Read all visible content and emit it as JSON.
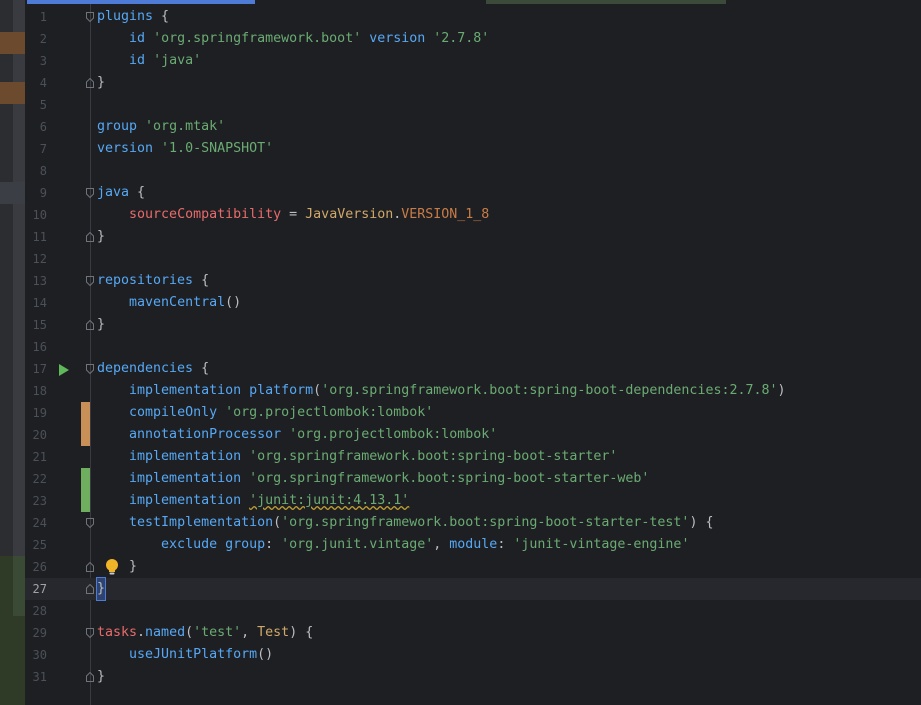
{
  "editor": {
    "lines": [
      {
        "n": "1",
        "tokens": [
          [
            "kw",
            "plugins"
          ],
          [
            "ident",
            " {"
          ]
        ],
        "fold": "open"
      },
      {
        "n": "2",
        "tokens": [
          [
            "ident",
            "    "
          ],
          [
            "kw",
            "id "
          ],
          [
            "str",
            "'org.springframework.boot'"
          ],
          [
            "kw",
            " version "
          ],
          [
            "str",
            "'2.7.8'"
          ]
        ]
      },
      {
        "n": "3",
        "tokens": [
          [
            "ident",
            "    "
          ],
          [
            "kw",
            "id "
          ],
          [
            "str",
            "'java'"
          ]
        ]
      },
      {
        "n": "4",
        "tokens": [
          [
            "ident",
            "}"
          ]
        ],
        "fold": "close"
      },
      {
        "n": "5",
        "tokens": []
      },
      {
        "n": "6",
        "tokens": [
          [
            "kw",
            "group "
          ],
          [
            "str",
            "'org.mtak'"
          ]
        ]
      },
      {
        "n": "7",
        "tokens": [
          [
            "kw",
            "version "
          ],
          [
            "str",
            "'1.0-SNAPSHOT'"
          ]
        ]
      },
      {
        "n": "8",
        "tokens": []
      },
      {
        "n": "9",
        "tokens": [
          [
            "kw",
            "java"
          ],
          [
            "ident",
            " {"
          ]
        ],
        "fold": "open"
      },
      {
        "n": "10",
        "tokens": [
          [
            "ident",
            "    "
          ],
          [
            "red",
            "sourceCompatibility"
          ],
          [
            "ident",
            " = "
          ],
          [
            "cls",
            "JavaVersion"
          ],
          [
            "ident",
            "."
          ],
          [
            "const",
            "VERSION_1_8"
          ]
        ]
      },
      {
        "n": "11",
        "tokens": [
          [
            "ident",
            "}"
          ]
        ],
        "fold": "close"
      },
      {
        "n": "12",
        "tokens": []
      },
      {
        "n": "13",
        "tokens": [
          [
            "kw",
            "repositories"
          ],
          [
            "ident",
            " {"
          ]
        ],
        "fold": "open"
      },
      {
        "n": "14",
        "tokens": [
          [
            "ident",
            "    "
          ],
          [
            "kw",
            "mavenCentral"
          ],
          [
            "ident",
            "()"
          ]
        ]
      },
      {
        "n": "15",
        "tokens": [
          [
            "ident",
            "}"
          ]
        ],
        "fold": "close"
      },
      {
        "n": "16",
        "tokens": []
      },
      {
        "n": "17",
        "tokens": [
          [
            "kw",
            "dependencies"
          ],
          [
            "ident",
            " {"
          ]
        ],
        "fold": "open",
        "run": true
      },
      {
        "n": "18",
        "tokens": [
          [
            "ident",
            "    "
          ],
          [
            "kw",
            "implementation "
          ],
          [
            "kw",
            "platform"
          ],
          [
            "ident",
            "("
          ],
          [
            "str",
            "'org.springframework.boot:spring-boot-dependencies:2.7.8'"
          ],
          [
            "ident",
            ")"
          ]
        ]
      },
      {
        "n": "19",
        "tokens": [
          [
            "ident",
            "    "
          ],
          [
            "kw",
            "compileOnly "
          ],
          [
            "str",
            "'org.projectlombok:lombok'"
          ]
        ],
        "change": "modified"
      },
      {
        "n": "20",
        "tokens": [
          [
            "ident",
            "    "
          ],
          [
            "kw",
            "annotationProcessor "
          ],
          [
            "str",
            "'org.projectlombok:lombok'"
          ]
        ],
        "change": "modified"
      },
      {
        "n": "21",
        "tokens": [
          [
            "ident",
            "    "
          ],
          [
            "kw",
            "implementation "
          ],
          [
            "str",
            "'org.springframework.boot:spring-boot-starter'"
          ]
        ]
      },
      {
        "n": "22",
        "tokens": [
          [
            "ident",
            "    "
          ],
          [
            "kw",
            "implementation "
          ],
          [
            "str",
            "'org.springframework.boot:spring-boot-starter-web'"
          ]
        ],
        "change": "added"
      },
      {
        "n": "23",
        "tokens": [
          [
            "ident",
            "    "
          ],
          [
            "kw",
            "implementation "
          ],
          [
            "str",
            "'junit:junit:4.13.1'"
          ]
        ],
        "change": "added"
      },
      {
        "n": "24",
        "tokens": [
          [
            "ident",
            "    "
          ],
          [
            "kw",
            "testImplementation"
          ],
          [
            "ident",
            "("
          ],
          [
            "str",
            "'org.springframework.boot:spring-boot-starter-test'"
          ],
          [
            "ident",
            ") {"
          ]
        ],
        "fold": "open"
      },
      {
        "n": "25",
        "tokens": [
          [
            "ident",
            "        "
          ],
          [
            "kw",
            "exclude "
          ],
          [
            "kw",
            "group"
          ],
          [
            "ident",
            ": "
          ],
          [
            "str",
            "'org.junit.vintage'"
          ],
          [
            "ident",
            ", "
          ],
          [
            "kw",
            "module"
          ],
          [
            "ident",
            ": "
          ],
          [
            "str",
            "'junit-vintage-engine'"
          ]
        ]
      },
      {
        "n": "26",
        "tokens": [
          [
            "ident",
            "    }"
          ]
        ],
        "fold": "close",
        "bulb": true
      },
      {
        "n": "27",
        "tokens": [
          [
            "ident",
            "}"
          ]
        ],
        "fold": "close",
        "current": true
      },
      {
        "n": "28",
        "tokens": []
      },
      {
        "n": "29",
        "tokens": [
          [
            "red",
            "tasks"
          ],
          [
            "ident",
            "."
          ],
          [
            "kw",
            "named"
          ],
          [
            "ident",
            "("
          ],
          [
            "str",
            "'test'"
          ],
          [
            "ident",
            ", "
          ],
          [
            "cls",
            "Test"
          ],
          [
            "ident",
            ") {"
          ]
        ],
        "fold": "open"
      },
      {
        "n": "30",
        "tokens": [
          [
            "ident",
            "    "
          ],
          [
            "kw",
            "useJUnitPlatform"
          ],
          [
            "ident",
            "()"
          ]
        ]
      },
      {
        "n": "31",
        "tokens": [
          [
            "ident",
            "}"
          ]
        ],
        "fold": "close"
      }
    ]
  },
  "colors": {
    "background": "#1e1f22",
    "keyword": "#56a8f5",
    "string": "#6aab73",
    "property": "#e86b6b",
    "class": "#d0a86a",
    "constant": "#c87c48",
    "modified_marker": "#c88f56",
    "added_marker": "#6fae5e",
    "run_icon": "#5fb85a",
    "bulb_icon": "#f0b429"
  },
  "icons": [
    "run-gutter-icon",
    "lightbulb-icon",
    "fold-open-icon",
    "fold-close-icon"
  ]
}
